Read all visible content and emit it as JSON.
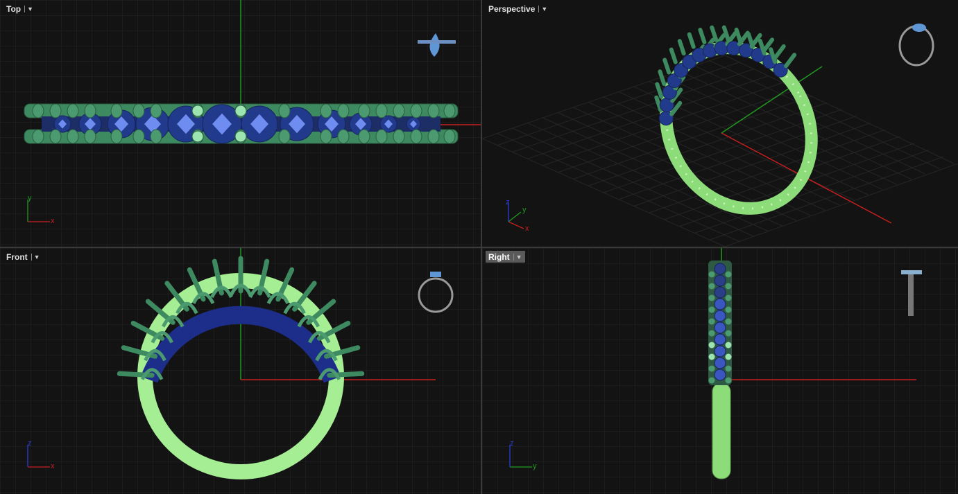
{
  "viewports": [
    {
      "id": "top",
      "label": "Top",
      "active": false,
      "axes": [
        "x",
        "y"
      ]
    },
    {
      "id": "perspective",
      "label": "Perspective",
      "active": false,
      "axes": [
        "x",
        "y",
        "z"
      ]
    },
    {
      "id": "front",
      "label": "Front",
      "active": false,
      "axes": [
        "x",
        "z"
      ]
    },
    {
      "id": "right",
      "label": "Right",
      "active": true,
      "axes": [
        "y",
        "z"
      ]
    }
  ],
  "dropdown_icon": "chevron-down-icon",
  "colors": {
    "background": "#131313",
    "grid": "#262626",
    "axis_x": "#c81e1e",
    "axis_y": "#1f9a1f",
    "axis_z": "#2a3fd6",
    "shank": "#a6ee93",
    "prongs": "#3e8a60",
    "stones": "#223a8c",
    "stone_highlight": "#6f8df0",
    "active_label_bg": "#5a5a5a"
  }
}
